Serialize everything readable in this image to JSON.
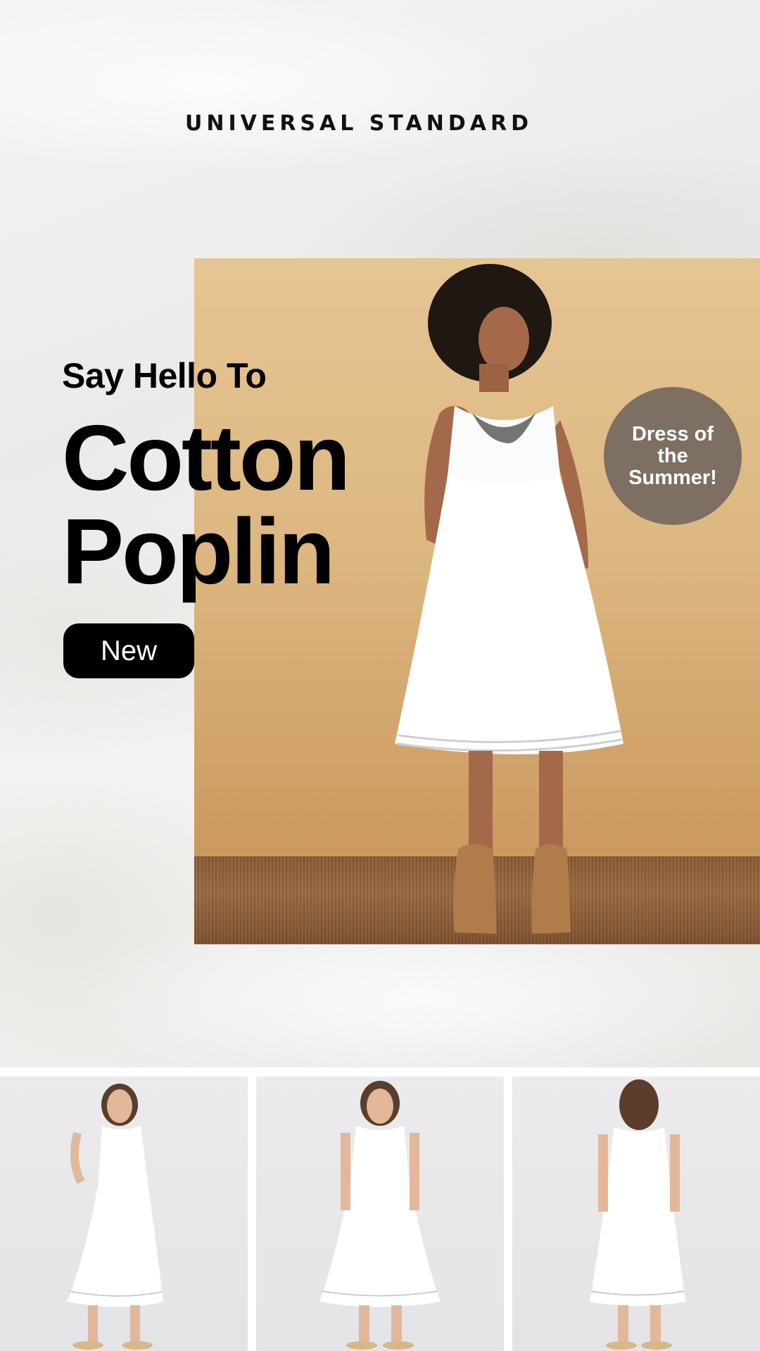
{
  "brand": {
    "name": "UNIVERSAL STANDARD"
  },
  "hero": {
    "intro": "Say Hello To",
    "title_line1": "Cotton",
    "title_line2": "Poplin",
    "tag_label": "New",
    "badge_text": "Dress of the Summer!"
  },
  "gallery": {
    "items": [
      {
        "view": "side"
      },
      {
        "view": "front"
      },
      {
        "view": "back"
      }
    ]
  },
  "colors": {
    "backdrop": "#dcb67f",
    "badge": "#7d7063",
    "pill": "#000000",
    "dress": "#ffffff"
  }
}
